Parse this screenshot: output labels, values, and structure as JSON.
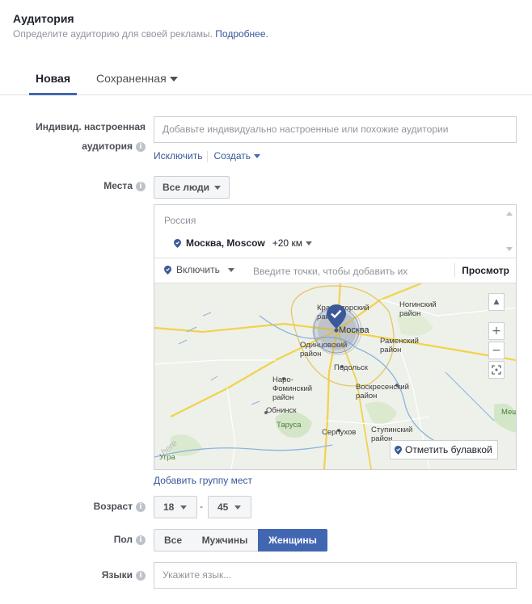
{
  "header": {
    "title": "Аудитория",
    "subtitle": "Определите аудиторию для своей рекламы.",
    "learn_more": "Подробнее."
  },
  "tabs": [
    {
      "label": "Новая",
      "active": true
    },
    {
      "label": "Сохраненная",
      "active": false
    }
  ],
  "custom_audience": {
    "label_line1": "Индивид. настроенная",
    "label_line2": "аудитория",
    "placeholder": "Добавьте индивидуально настроенные или похожие аудитории",
    "exclude_link": "Исключить",
    "create_link": "Создать"
  },
  "places": {
    "label": "Места",
    "people_select": "Все люди",
    "country": "Россия",
    "city": "Москва, Moscow",
    "radius": "+20 км",
    "include_select": "Включить",
    "points_placeholder": "Введите точки, чтобы добавить их",
    "view_link": "Просмотр",
    "drop_pin": "Отметить булавкой",
    "add_group": "Добавить группу мест"
  },
  "map": {
    "labels": {
      "krasnogorsk1": "Красногорский",
      "krasnogorsk2": "район",
      "moscow": "Москва",
      "odintsovo1": "Одинцовский",
      "odintsovo2": "район",
      "noginsk1": "Ногинский",
      "noginsk2": "район",
      "ramenskoe1": "Раменский",
      "ramenskoe2": "район",
      "podolsk": "Подольск",
      "naro1": "Наро-",
      "naro2": "Фоминский",
      "naro3": "район",
      "voskresensk1": "Воскресенский",
      "voskresensk2": "район",
      "obninsk": "Обнинск",
      "tarusa": "Таруса",
      "serpukhov": "Серпухов",
      "stupino1": "Ступинский",
      "stupino2": "район",
      "uva": "Угра",
      "meshch": "Мещ",
      "here": "here"
    },
    "zoom_in": "+",
    "zoom_out": "−"
  },
  "age": {
    "label": "Возраст",
    "min": "18",
    "max": "45",
    "separator": "-"
  },
  "gender": {
    "label": "Пол",
    "options": [
      "Все",
      "Мужчины",
      "Женщины"
    ],
    "selected": "Женщины"
  },
  "languages": {
    "label": "Языки",
    "placeholder": "Укажите язык..."
  },
  "colors": {
    "accent": "#4267b2",
    "link": "#365899",
    "pin": "#3b5998"
  }
}
